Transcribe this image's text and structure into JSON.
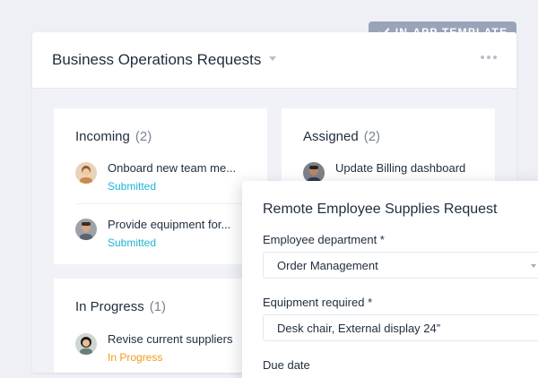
{
  "badge": {
    "label": "IN-APP TEMPLATE",
    "icon": "checkmark-icon"
  },
  "board": {
    "title": "Business Operations Requests"
  },
  "columns": {
    "incoming": {
      "name": "Incoming",
      "count": "(2)",
      "cards": [
        {
          "title": "Onboard new team me...",
          "status": "Submitted"
        },
        {
          "title": "Provide equipment for...",
          "status": "Submitted"
        }
      ]
    },
    "assigned": {
      "name": "Assigned",
      "count": "(2)",
      "cards": [
        {
          "title": "Update Billing dashboard"
        }
      ]
    },
    "in_progress": {
      "name": "In Progress",
      "count": "(1)",
      "cards": [
        {
          "title": "Revise current suppliers",
          "status": "In Progress"
        }
      ]
    }
  },
  "form": {
    "title": "Remote Employee Supplies Request",
    "department_label": "Employee department *",
    "department_value": "Order Management",
    "equipment_label": "Equipment required *",
    "equipment_value": "Desk chair, External display 24”",
    "due_label": "Due date"
  },
  "colors": {
    "submitted": "#1fb5d4",
    "in_progress": "#f29a1a",
    "badge_bg": "#9aa4b8"
  }
}
